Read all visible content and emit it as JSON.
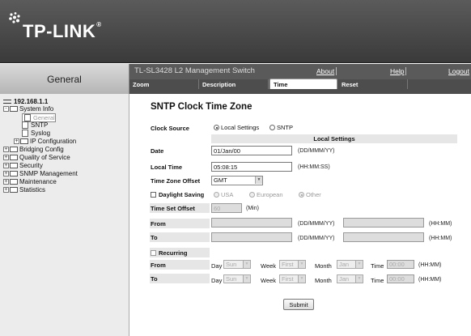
{
  "brand": {
    "logo": "TP-LINK",
    "trademark": "®"
  },
  "left_header": "General",
  "top": {
    "device": "TL-SL3428 L2 Management Switch",
    "about": "About",
    "help": "Help",
    "logout": "Logout"
  },
  "tabs": [
    {
      "label": "Zoom"
    },
    {
      "label": "Description"
    },
    {
      "label": "Time"
    },
    {
      "label": "Reset"
    }
  ],
  "sidebar": {
    "root": "192.168.1.1",
    "items": [
      {
        "label": "System Info"
      },
      {
        "label": "General"
      },
      {
        "label": "SNTP"
      },
      {
        "label": "Syslog"
      },
      {
        "label": "IP Configuration"
      },
      {
        "label": "Bridging Config"
      },
      {
        "label": "Quality of Service"
      },
      {
        "label": "Security"
      },
      {
        "label": "SNMP Management"
      },
      {
        "label": "Maintenance"
      },
      {
        "label": "Statistics"
      }
    ]
  },
  "form": {
    "title": "SNTP Clock Time Zone",
    "clock_source_label": "Clock Source",
    "opt_local_settings": "Local Settings",
    "opt_sntp": "SNTP",
    "local_settings_header": "Local Settings",
    "date_label": "Date",
    "date_value": "01/Jan/00",
    "date_unit": "(DD/MMM/YY)",
    "local_time_label": "Local Time",
    "local_time_value": "05:08:15",
    "local_time_unit": "(HH:MM:SS)",
    "tz_offset_label": "Time Zone Offset",
    "tz_offset_value": "GMT",
    "daylight_label": "Daylight Saving",
    "opt_usa": "USA",
    "opt_european": "European",
    "opt_other": "Other",
    "time_set_offset_label": "Time Set Offset",
    "time_set_offset_value": "60",
    "min_unit": "(Min)",
    "from_label": "From",
    "to_label": "To",
    "ddmmmyy": "(DD/MMM/YY)",
    "hhmm": "(HH:MM)",
    "recurring_label": "Recurring",
    "day_label": "Day",
    "day_value": "Sun",
    "week_label": "Week",
    "week_value": "First",
    "month_label": "Month",
    "month_value": "Jan",
    "time_label": "Time",
    "time_value": "00:00",
    "submit": "Submit"
  }
}
